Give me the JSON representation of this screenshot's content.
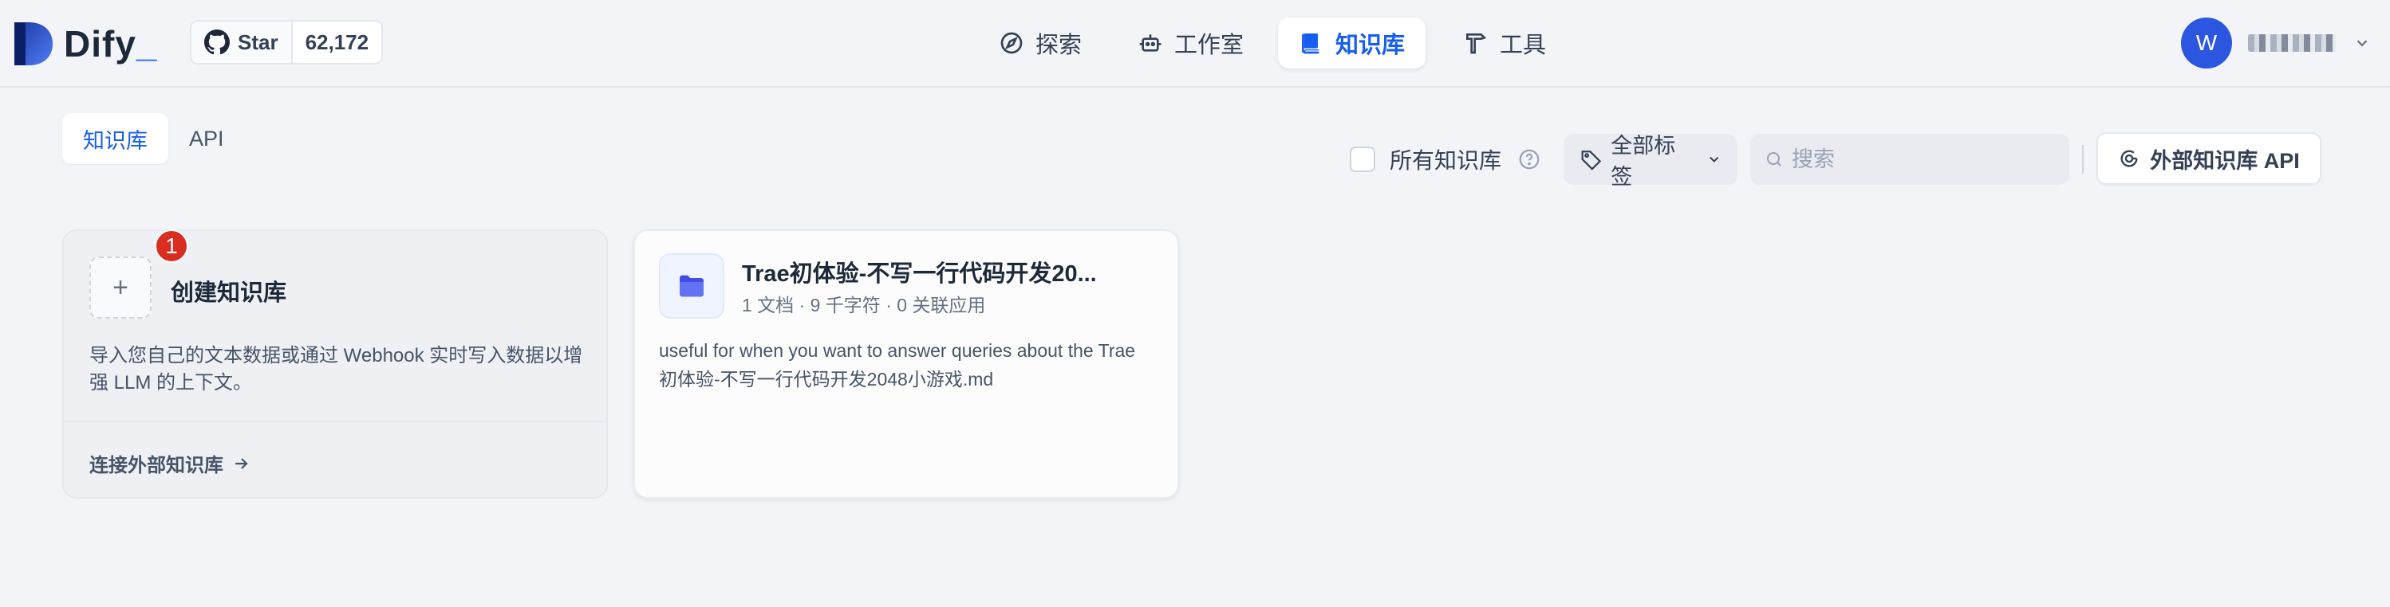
{
  "header": {
    "logo_text": "Dify",
    "logo_dot": "_",
    "github": {
      "star_label": "Star",
      "star_count": "62,172"
    },
    "nav": [
      {
        "label": "探索",
        "icon": "compass-icon"
      },
      {
        "label": "工作室",
        "icon": "robot-icon"
      },
      {
        "label": "知识库",
        "icon": "book-icon",
        "active": true
      },
      {
        "label": "工具",
        "icon": "hammer-icon"
      }
    ],
    "user": {
      "avatar_initial": "W"
    }
  },
  "toolbar": {
    "tabs": [
      {
        "label": "知识库",
        "active": true
      },
      {
        "label": "API",
        "active": false
      }
    ],
    "all_kb_label": "所有知识库",
    "tag_filter_label": "全部标签",
    "search_placeholder": "搜索",
    "external_api_label": "外部知识库 API"
  },
  "create_card": {
    "title": "创建知识库",
    "badge": "1",
    "description": "导入您自己的文本数据或通过 Webhook 实时写入数据以增强 LLM 的上下文。",
    "connect_link": "连接外部知识库"
  },
  "datasets": [
    {
      "title": "Trae初体验-不写一行代码开发20...",
      "meta": "1 文档 · 9 千字符 · 0 关联应用",
      "description": "useful for when you want to answer queries about the Trae初体验-不写一行代码开发2048小游戏.md"
    }
  ],
  "colors": {
    "accent": "#155eef",
    "avatar": "#2c56e0",
    "badge": "#d92d20",
    "background": "#f2f4f7"
  }
}
